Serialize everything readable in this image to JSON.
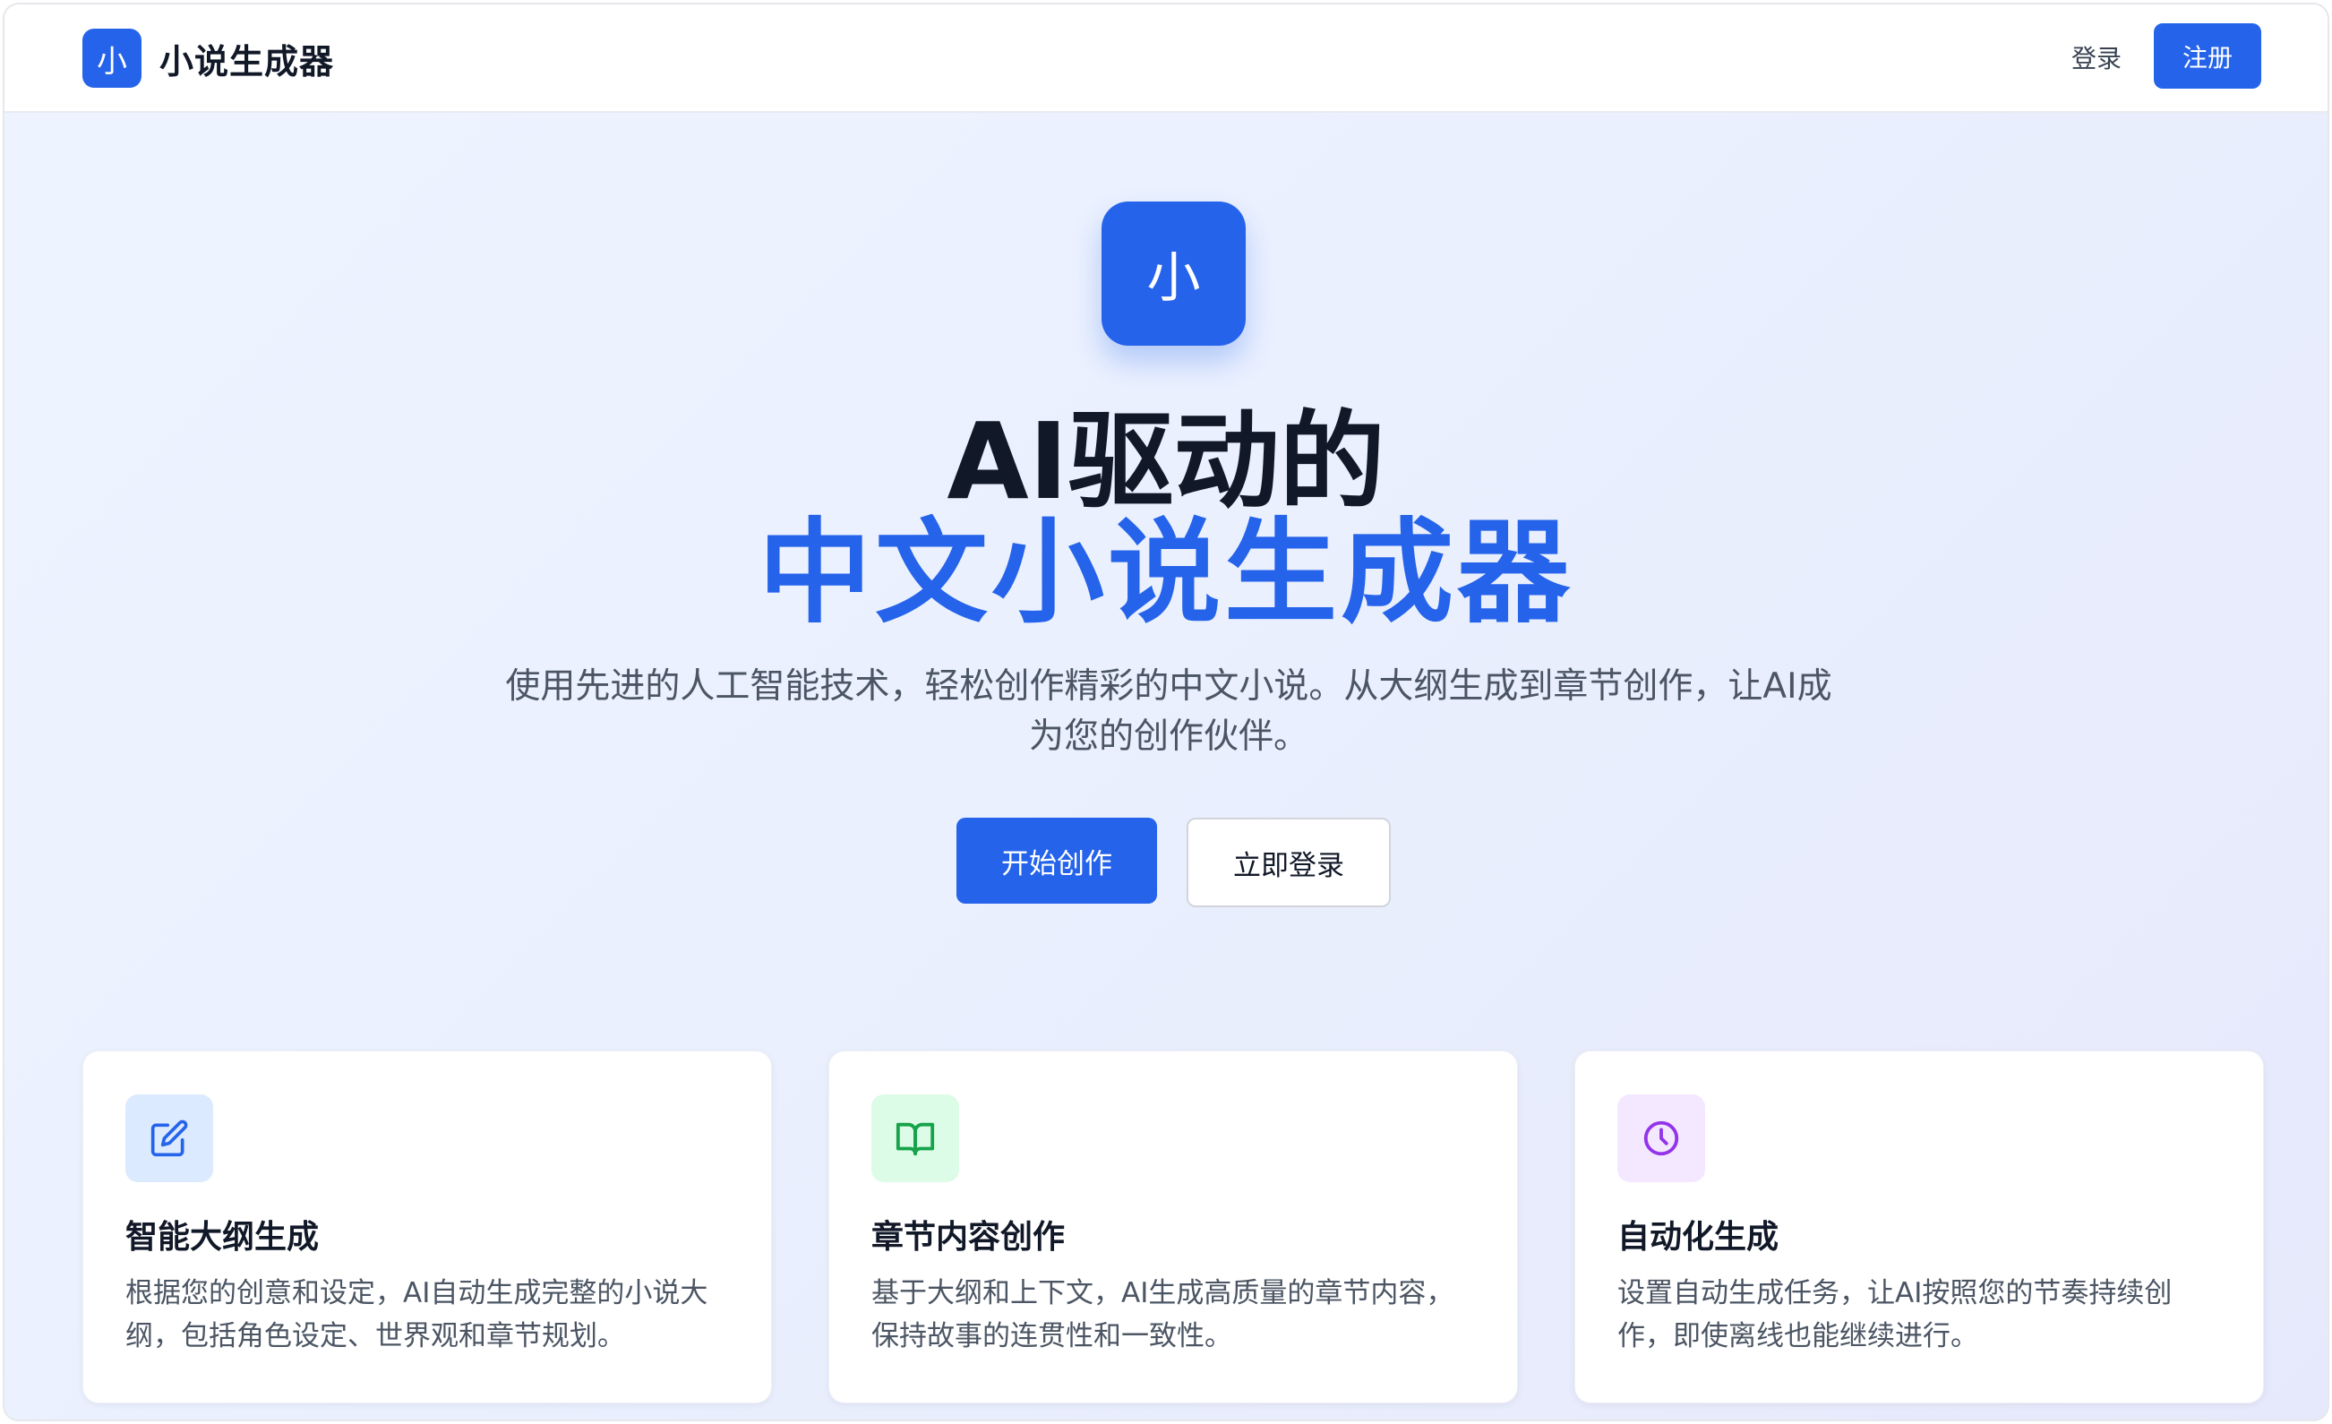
{
  "header": {
    "brand_logo_char": "小",
    "brand_name": "小说生成器",
    "login_label": "登录",
    "register_label": "注册"
  },
  "hero": {
    "logo_char": "小",
    "title_line1": "AI驱动的",
    "title_line2": "中文小说生成器",
    "description_line1": "使用先进的人工智能技术，轻松创作精彩的中文小说。从大纲生成到章节创作，让AI成",
    "description_line2": "为您的创作伙伴。",
    "primary_button": "开始创作",
    "secondary_button": "立即登录"
  },
  "features": [
    {
      "icon": "edit-icon",
      "title": "智能大纲生成",
      "desc_line1": "根据您的创意和设定，AI自动生成完整的小说大",
      "desc_line2": "纲，包括角色设定、世界观和章节规划。"
    },
    {
      "icon": "book-open-icon",
      "title": "章节内容创作",
      "desc_line1": "基于大纲和上下文，AI生成高质量的章节内容，",
      "desc_line2": "保持故事的连贯性和一致性。"
    },
    {
      "icon": "clock-icon",
      "title": "自动化生成",
      "desc_line1": "设置自动生成任务，让AI按照您的节奏持续创",
      "desc_line2": "作，即使离线也能继续进行。"
    }
  ],
  "colors": {
    "primary": "#2563eb",
    "icon_bg_blue": "#dbeafe",
    "icon_bg_green": "#dcfce7",
    "icon_green": "#16a34a",
    "icon_bg_purple": "#f3e8ff",
    "icon_purple": "#9333ea"
  }
}
